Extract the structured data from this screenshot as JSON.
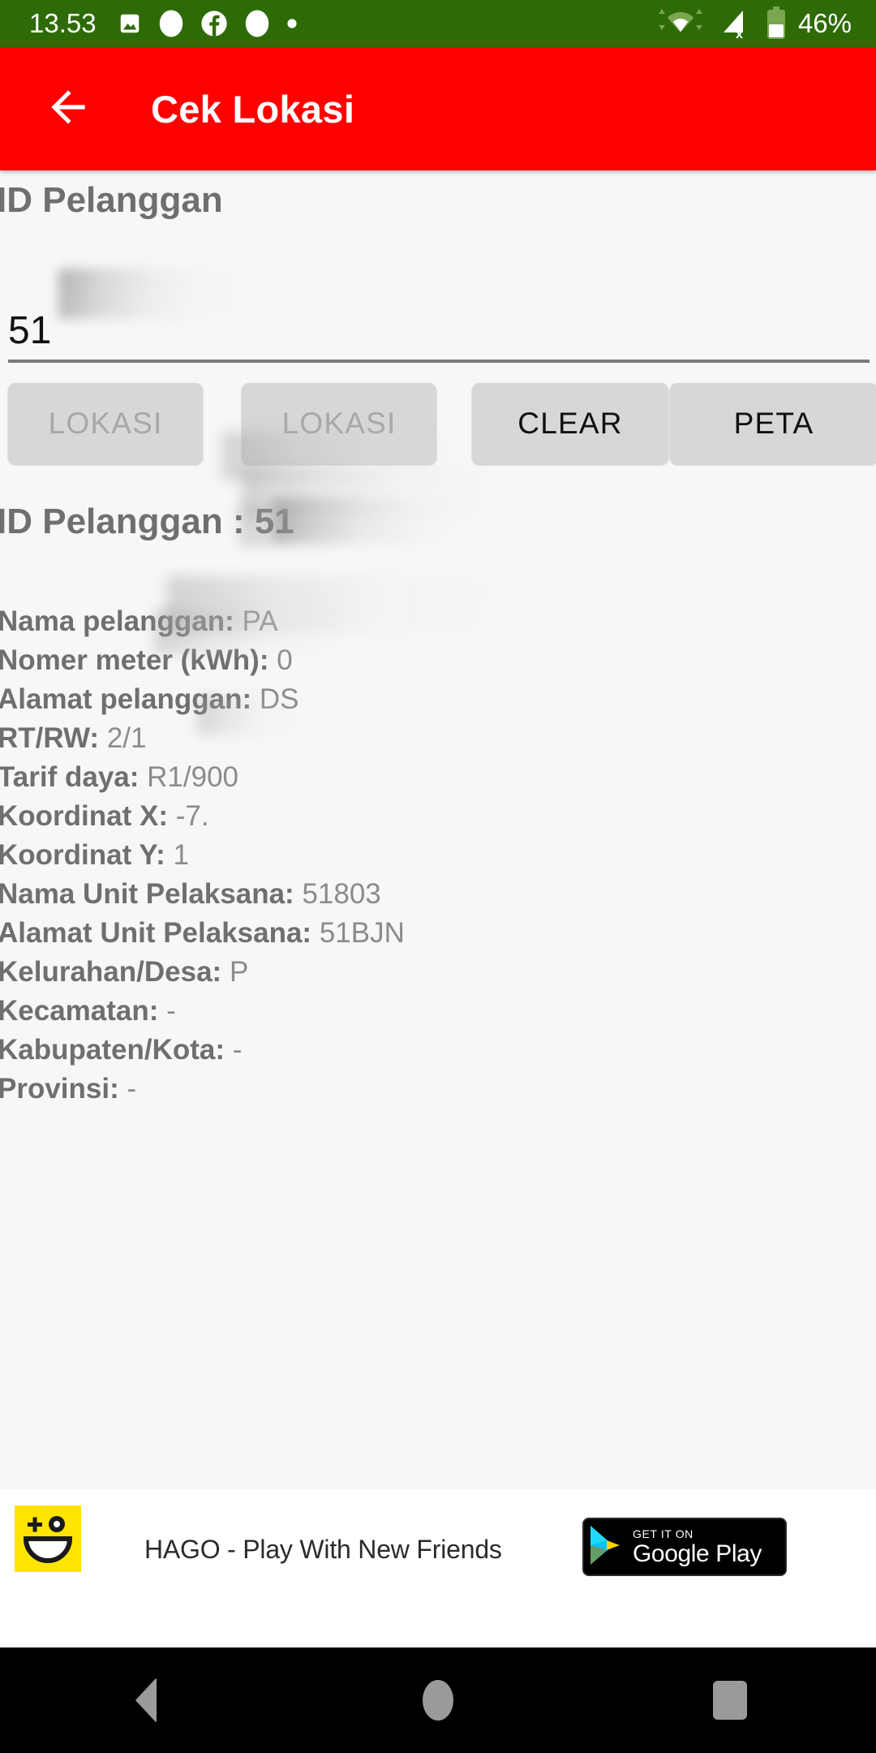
{
  "status_bar": {
    "time": "13.53",
    "battery_percent": "46%",
    "background_color": "#2e6b06",
    "notification_icons": [
      "image-icon",
      "circle-icon",
      "facebook-icon",
      "circle-icon",
      "dot-icon"
    ],
    "system_icons": [
      "wifi-transfer-icon",
      "cellular-no-service-icon",
      "battery-icon"
    ]
  },
  "app_bar": {
    "title": "Cek Lokasi",
    "back_label": "Back",
    "background_color": "#ff0000"
  },
  "form": {
    "field_label": "ID Pelanggan",
    "id_value": "51",
    "id_value_redacted": true
  },
  "buttons": [
    {
      "label": "LOKASI",
      "name": "lokasi-button-1",
      "enabled": false
    },
    {
      "label": "LOKASI",
      "name": "lokasi-button-2",
      "enabled": false
    },
    {
      "label": "CLEAR",
      "name": "clear-button",
      "enabled": true
    },
    {
      "label": "PETA",
      "name": "peta-button",
      "enabled": true
    }
  ],
  "result": {
    "heading_label": "ID Pelanggan : ",
    "heading_value": "51",
    "rows": [
      {
        "label": "Nama pelanggan:",
        "value": "PA",
        "redacted": true
      },
      {
        "label": "Nomer meter (kWh):",
        "value": "0",
        "redacted": true
      },
      {
        "label": "Alamat pelanggan:",
        "value": "DS",
        "redacted": true
      },
      {
        "label": "RT/RW:",
        "value": "2/1",
        "redacted": false
      },
      {
        "label": "Tarif daya:",
        "value": "R1/900",
        "redacted": false
      },
      {
        "label": "Koordinat X:",
        "value": "-7.",
        "redacted": true
      },
      {
        "label": "Koordinat Y:",
        "value": "1",
        "redacted": true
      },
      {
        "label": "Nama Unit Pelaksana:",
        "value": "51803",
        "redacted": false
      },
      {
        "label": "Alamat Unit Pelaksana:",
        "value": "51BJN",
        "redacted": false
      },
      {
        "label": "Kelurahan/Desa:",
        "value": "P",
        "redacted": true
      },
      {
        "label": "Kecamatan:",
        "value": "-",
        "redacted": false
      },
      {
        "label": "Kabupaten/Kota:",
        "value": "-",
        "redacted": false
      },
      {
        "label": "Provinsi:",
        "value": "-",
        "redacted": false
      }
    ]
  },
  "ad": {
    "title": "HAGO - Play With New Friends",
    "cta_small": "GET IT ON",
    "cta_big": "Google Play",
    "icon_color": "#ffe400"
  },
  "nav_bar": {
    "back_label": "Back",
    "home_label": "Home",
    "recents_label": "Recents"
  }
}
